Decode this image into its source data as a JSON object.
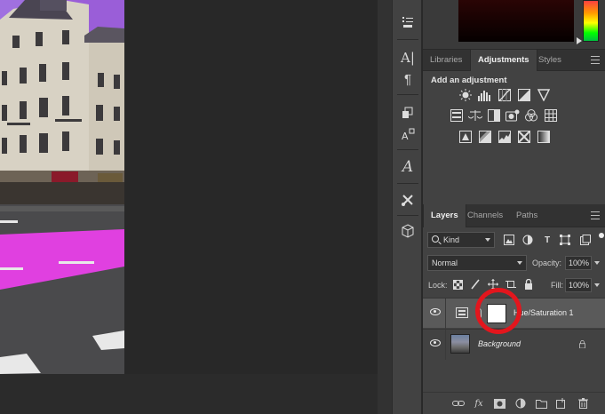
{
  "panels": {
    "upper_tabs": [
      {
        "label": "Libraries",
        "active": false
      },
      {
        "label": "Adjustments",
        "active": true
      },
      {
        "label": "Styles",
        "active": false
      }
    ],
    "adjustments": {
      "heading": "Add an adjustment",
      "row1": [
        "brightness-contrast-icon",
        "levels-icon",
        "curves-icon",
        "exposure-icon",
        "gradient-triangle-icon"
      ],
      "row2": [
        "vibrance-icon",
        "hue-saturation-icon",
        "color-balance-icon",
        "black-white-icon",
        "photo-filter-icon",
        "channel-mixer-icon",
        "color-lookup-icon"
      ],
      "row3": [
        "invert-icon",
        "posterize-icon",
        "threshold-icon",
        "selective-color-icon",
        "gradient-map-icon"
      ]
    },
    "lower_tabs": [
      {
        "label": "Layers",
        "active": true
      },
      {
        "label": "Channels",
        "active": false
      },
      {
        "label": "Paths",
        "active": false
      }
    ],
    "layers": {
      "kind_label": "Kind",
      "blend_mode": "Normal",
      "opacity_label": "Opacity:",
      "opacity_value": "100%",
      "lock_label": "Lock:",
      "fill_label": "Fill:",
      "fill_value": "100%",
      "items": [
        {
          "name": "Hue/Saturation 1",
          "type": "adjustment",
          "selected": true,
          "visible": true
        },
        {
          "name": "Background",
          "type": "image",
          "selected": false,
          "visible": true,
          "locked": true
        }
      ]
    }
  },
  "colors": {
    "panel_bg": "#424242",
    "canvas_bg": "#282828",
    "highlight_ring": "#e3161d",
    "road_magenta": "#e040e0"
  }
}
